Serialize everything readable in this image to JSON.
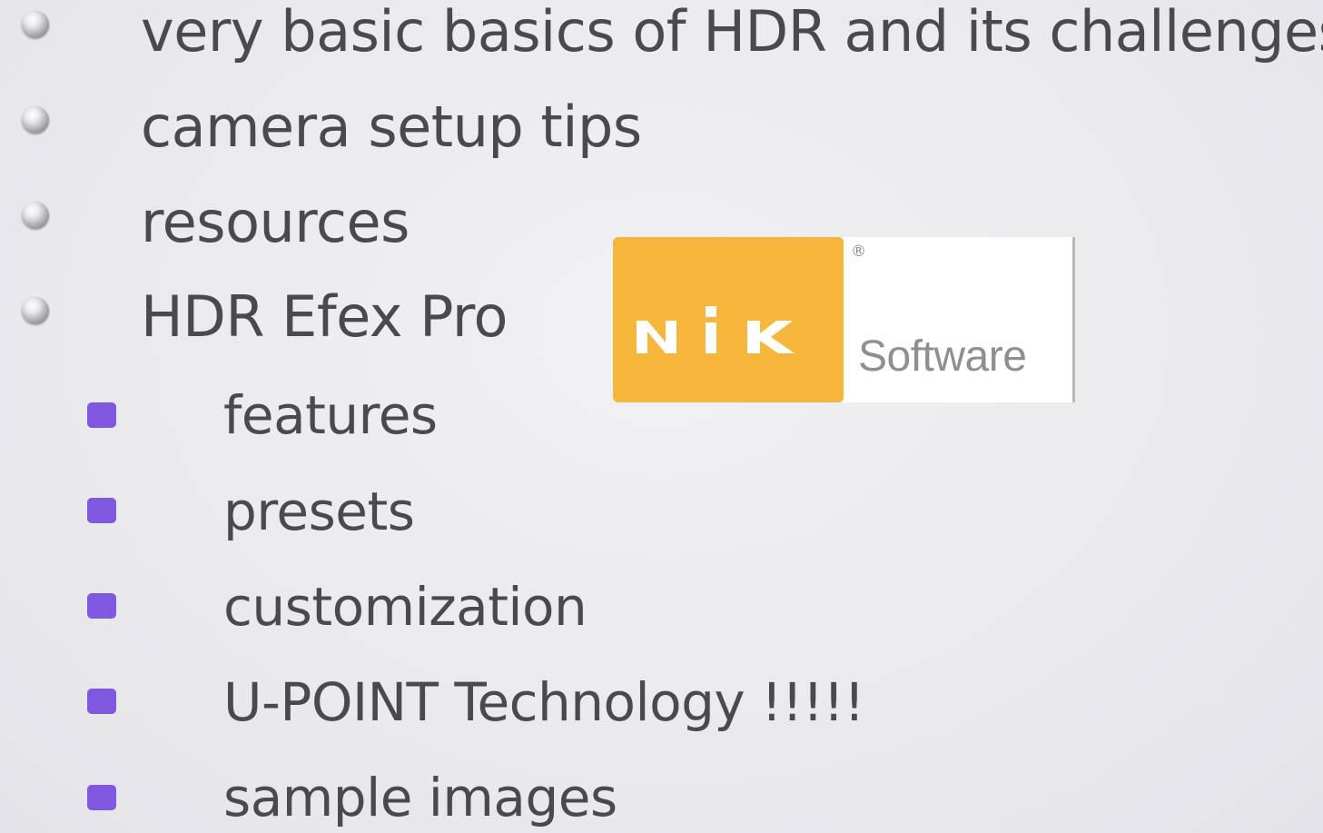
{
  "slide": {
    "bullets": [
      {
        "text": "very basic basics of HDR and its challenges"
      },
      {
        "text": "camera setup tips"
      },
      {
        "text": "resources"
      },
      {
        "text": "HDR Efex Pro"
      }
    ],
    "sub_bullets": [
      {
        "text": "features"
      },
      {
        "text": "presets"
      },
      {
        "text": "customization"
      },
      {
        "text": "U-POINT Technology !!!!!"
      },
      {
        "text": "sample images"
      }
    ]
  },
  "logo": {
    "wordmark": "Software",
    "registered": "®",
    "mark_text": "NIK",
    "colors": {
      "orange": "#f6b53b",
      "white": "#ffffff",
      "gray": "#8d8f93"
    }
  },
  "colors": {
    "background": "#ececef",
    "text": "#4a4a4c",
    "sub_bullet": "#8058e0"
  }
}
